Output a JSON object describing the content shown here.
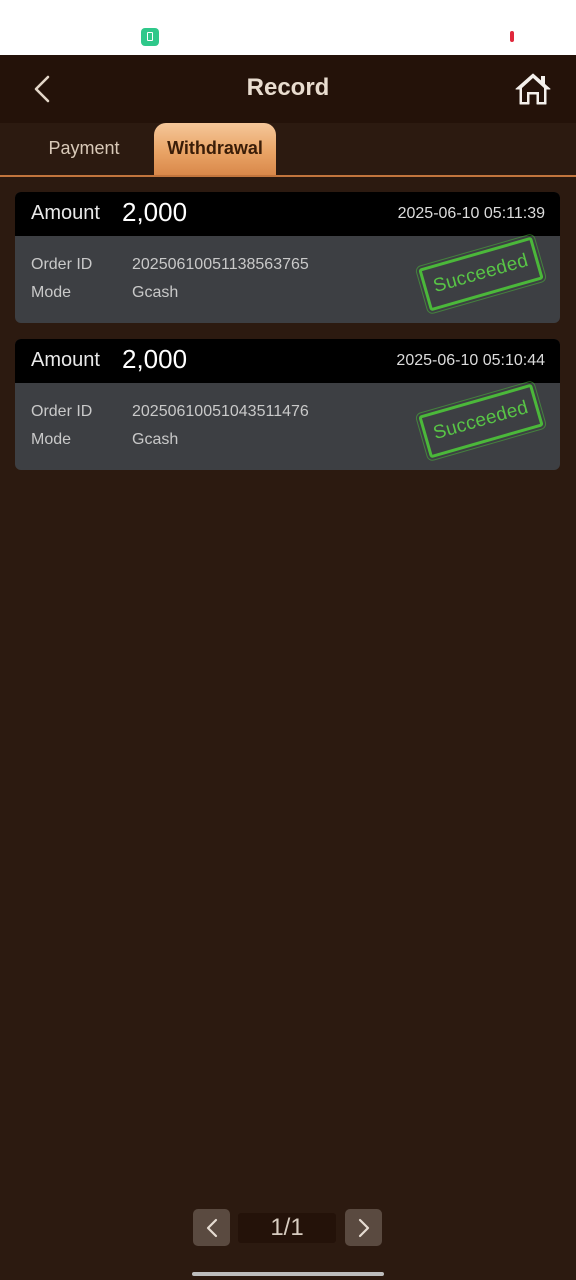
{
  "colors": {
    "background": "#2c1a10",
    "header": "#241209",
    "active_tab": "#e9a466",
    "stamp_green": "#4bb83a"
  },
  "header": {
    "title": "Record",
    "back_icon": "chevron-left-icon",
    "home_icon": "home-icon"
  },
  "tabs": [
    {
      "label": "Payment",
      "active": false
    },
    {
      "label": "Withdrawal",
      "active": true
    }
  ],
  "records": [
    {
      "amount_label": "Amount",
      "amount": "2,000",
      "time": "2025-06-10 05:11:39",
      "order_label": "Order ID",
      "order_id": "20250610051138563765",
      "mode_label": "Mode",
      "mode": "Gcash",
      "status": "Succeeded"
    },
    {
      "amount_label": "Amount",
      "amount": "2,000",
      "time": "2025-06-10 05:10:44",
      "order_label": "Order ID",
      "order_id": "20250610051043511476",
      "mode_label": "Mode",
      "mode": "Gcash",
      "status": "Succeeded"
    }
  ],
  "pagination": {
    "page": "1/1",
    "prev_icon": "chevron-left-icon",
    "next_icon": "chevron-right-icon"
  }
}
